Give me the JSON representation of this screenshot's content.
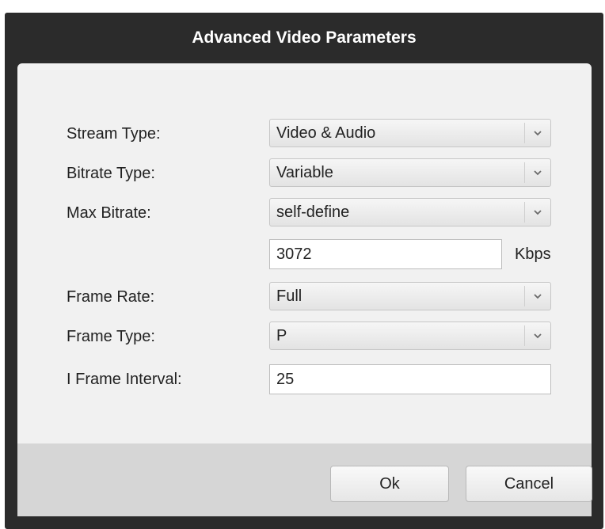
{
  "dialog": {
    "title": "Advanced Video Parameters"
  },
  "fields": {
    "stream_type": {
      "label": "Stream Type:",
      "value": "Video & Audio"
    },
    "bitrate_type": {
      "label": "Bitrate Type:",
      "value": "Variable"
    },
    "max_bitrate": {
      "label": "Max Bitrate:",
      "value": "self-define"
    },
    "custom_bitrate": {
      "value": "3072",
      "unit": "Kbps"
    },
    "frame_rate": {
      "label": "Frame Rate:",
      "value": "Full"
    },
    "frame_type": {
      "label": "Frame Type:",
      "value": "P"
    },
    "i_frame_interval": {
      "label": "I Frame Interval:",
      "value": "25"
    }
  },
  "buttons": {
    "ok": "Ok",
    "cancel": "Cancel"
  },
  "icons": {
    "dropdown": "chevron-down-icon"
  },
  "colors": {
    "titlebar": "#2b2b2b",
    "content_bg": "#f1f1f1",
    "footer_bg": "#d6d6d6"
  }
}
